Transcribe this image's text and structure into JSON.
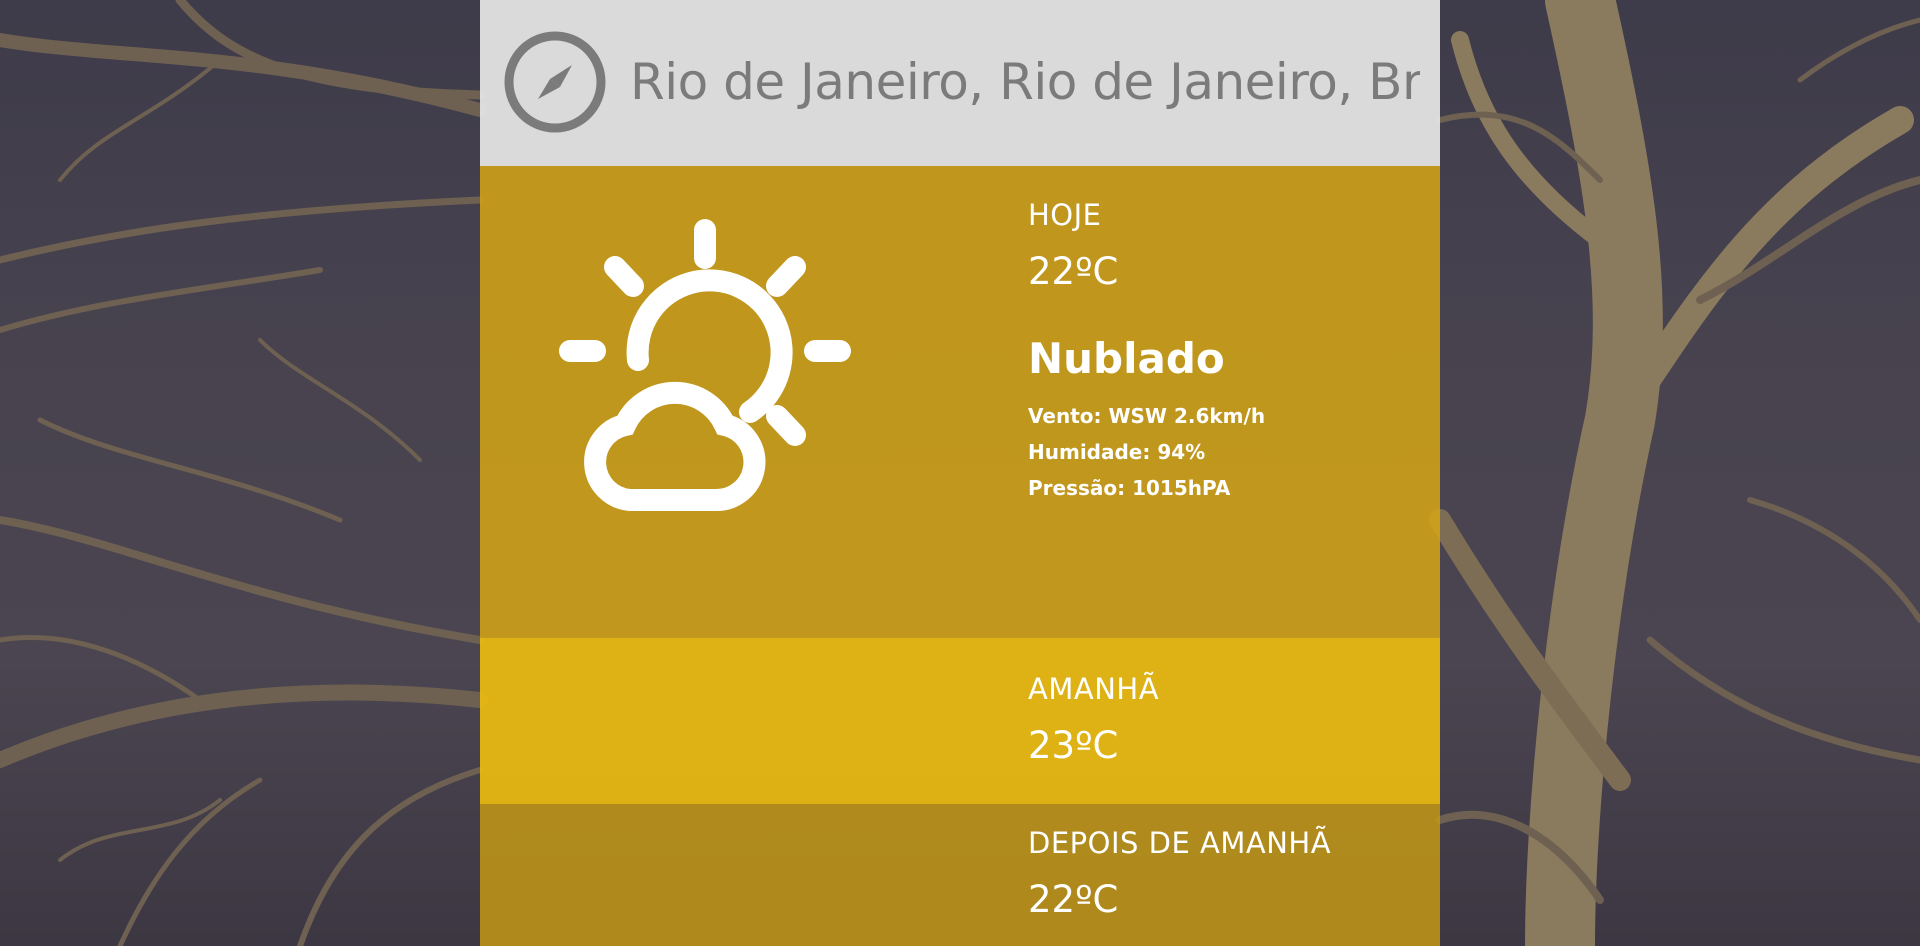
{
  "header": {
    "location": "Rio de Janeiro, Rio de Janeiro, Br",
    "icon": "compass-icon"
  },
  "today": {
    "label": "HOJE",
    "temperature": "22ºC",
    "condition": "Nublado",
    "wind": "Vento: WSW 2.6km/h",
    "humidity": "Humidade: 94%",
    "pressure": "Pressão: 1015hPA",
    "icon": "partly-cloudy-icon"
  },
  "tomorrow": {
    "label": "AMANHÃ",
    "temperature": "23ºC"
  },
  "day_after": {
    "label": "DEPOIS DE AMANHÃ",
    "temperature": "22ºC"
  },
  "colors": {
    "today_bg": "#d6a614",
    "tomorrow_bg": "#eebe0e",
    "day_after_bg": "#c89b14",
    "header_bg": "#e6e6e6",
    "header_text": "#7b7b7b"
  }
}
